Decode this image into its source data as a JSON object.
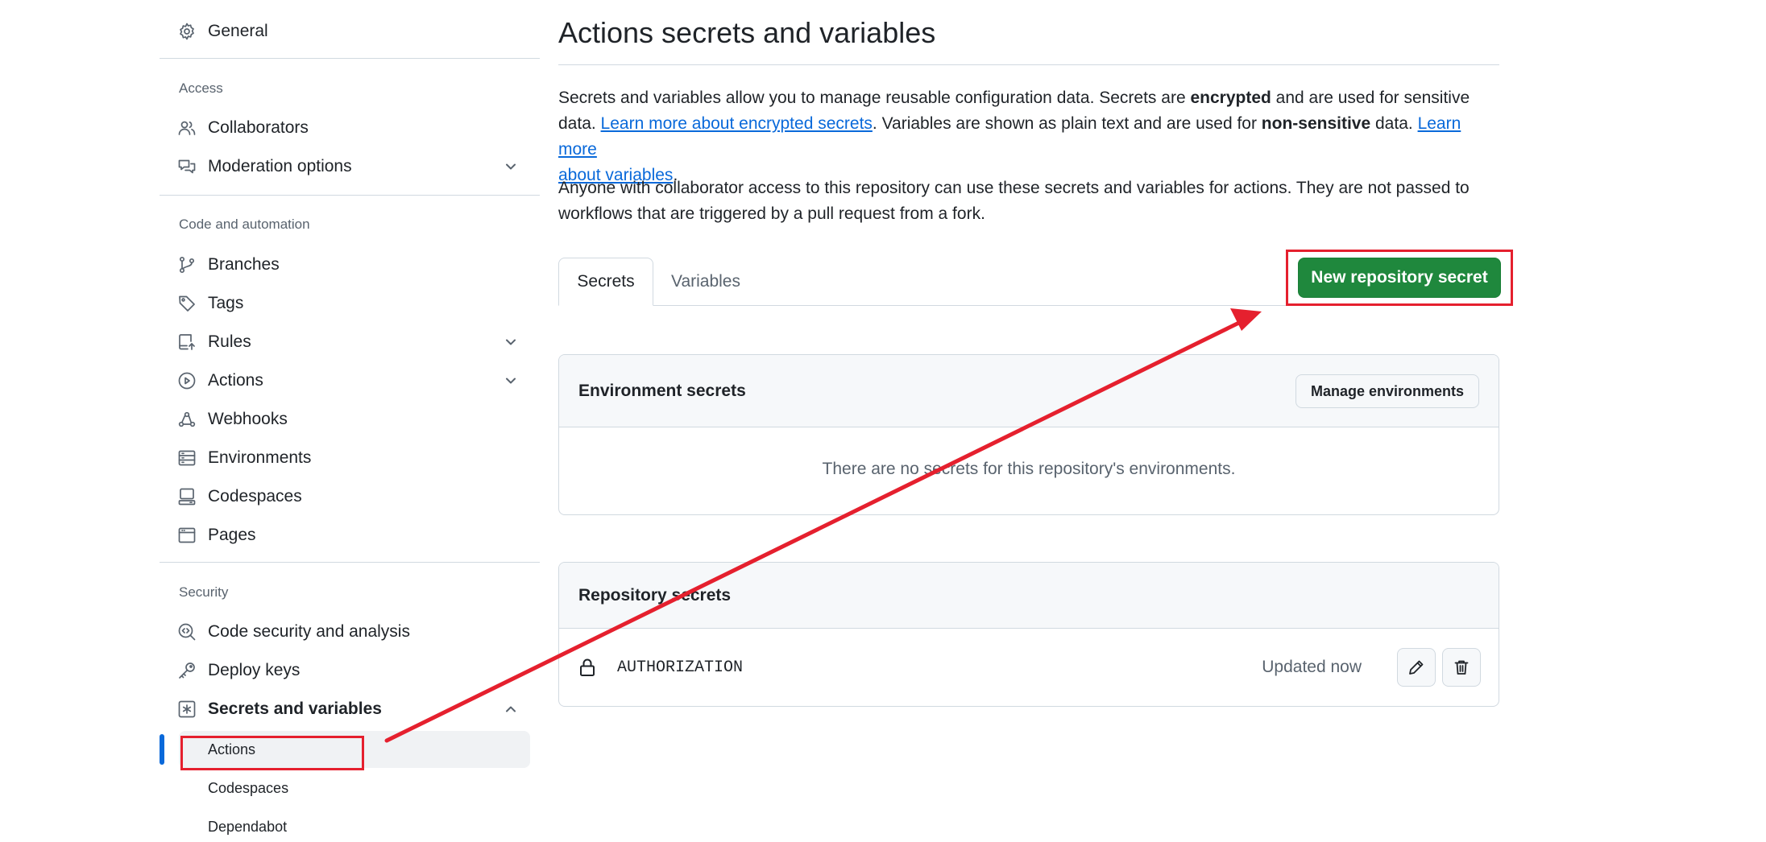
{
  "sidebar": {
    "general": "General",
    "sections": {
      "access": "Access",
      "code_automation": "Code and automation",
      "security": "Security"
    },
    "access_items": [
      "Collaborators",
      "Moderation options"
    ],
    "code_items": [
      "Branches",
      "Tags",
      "Rules",
      "Actions",
      "Webhooks",
      "Environments",
      "Codespaces",
      "Pages"
    ],
    "security_items": [
      "Code security and analysis",
      "Deploy keys",
      "Secrets and variables"
    ],
    "secrets_subitems": [
      "Actions",
      "Codespaces",
      "Dependabot"
    ],
    "active_subitem": "Actions",
    "icons": {
      "general": "gear-icon",
      "collaborators": "people-icon",
      "moderation": "comment-discussion-icon",
      "branches": "git-branch-icon",
      "tags": "tag-icon",
      "rules": "repo-push-icon",
      "actions": "play-icon",
      "webhooks": "webhook-icon",
      "environments": "server-icon",
      "codespaces": "codespaces-icon",
      "pages": "browser-icon",
      "code_security": "codescan-icon",
      "deploy_keys": "key-icon",
      "secrets": "key-asterisk-icon"
    }
  },
  "main": {
    "title": "Actions secrets and variables",
    "intro": {
      "p1_a": "Secrets and variables allow you to manage reusable configuration data. Secrets are ",
      "p1_b": "encrypted",
      "p1_c": " and are used for sensitive",
      "p1_d": "data. ",
      "p1_link1": "Learn more about encrypted secrets",
      "p1_e": ". Variables are shown as plain text and are used for ",
      "p1_f": "non-sensitive",
      "p1_g": " data. ",
      "p1_link2a": "Learn more",
      "p1_link2b": "about variables",
      "p1_h": ".",
      "p2_line1": "Anyone with collaborator access to this repository can use these secrets and variables for actions. They are not passed to",
      "p2_line2": "workflows that are triggered by a pull request from a fork."
    },
    "tabs": [
      "Secrets",
      "Variables"
    ],
    "selected_tab": "Secrets",
    "new_secret_button": "New repository secret",
    "environment_secrets": {
      "title": "Environment secrets",
      "manage_button": "Manage environments",
      "empty_text": "There are no secrets for this repository's environments."
    },
    "repository_secrets": {
      "title": "Repository secrets",
      "rows": [
        {
          "name": "AUTHORIZATION",
          "updated": "Updated now"
        }
      ]
    }
  },
  "colors": {
    "primary_button": "#1f883d",
    "link": "#0969da",
    "active_indicator": "#0969da",
    "annotation": "#e5202e"
  }
}
